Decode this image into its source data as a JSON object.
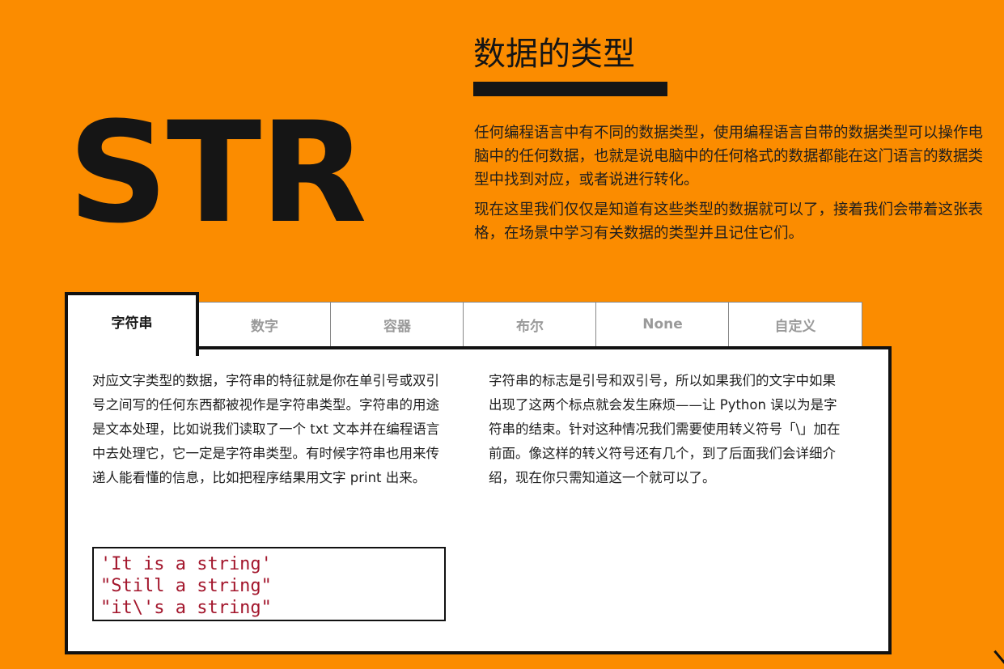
{
  "hero": {
    "text": "STR"
  },
  "section": {
    "title": "数据的类型"
  },
  "intro": {
    "paragraphs": [
      "任何编程语言中有不同的数据类型，使用编程语言自带的数据类型可以操作电脑中的任何数据，也就是说电脑中的任何格式的数据都能在这门语言的数据类型中找到对应，或者说进行转化。",
      "现在这里我们仅仅是知道有这些类型的数据就可以了，接着我们会带着这张表格，在场景中学习有关数据的类型并且记住它们。"
    ]
  },
  "tabs": [
    {
      "label": "字符串",
      "active": true
    },
    {
      "label": "数字",
      "active": false
    },
    {
      "label": "容器",
      "active": false
    },
    {
      "label": "布尔",
      "active": false
    },
    {
      "label": "None",
      "active": false
    },
    {
      "label": "自定义",
      "active": false
    }
  ],
  "panel": {
    "left_text": "对应文字类型的数据，字符串的特征就是你在单引号或双引号之间写的任何东西都被视作是字符串类型。字符串的用途是文本处理，比如说我们读取了一个 txt 文本并在编程语言中去处理它，它一定是字符串类型。有时候字符串也用来传递人能看懂的信息，比如把程序结果用文字 print 出来。",
    "right_text": "字符串的标志是引号和双引号，所以如果我们的文字中如果出现了这两个标点就会发生麻烦——让 Python 误以为是字符串的结束。针对这种情况我们需要使用转义符号「\\」加在前面。像这样的转义符号还有几个，到了后面我们会详细介绍，现在你只需知道这一个就可以了。",
    "code_lines": [
      "'It is a string'",
      "\"Still a string\"",
      "\"it\\'s a string\""
    ]
  },
  "colors": {
    "background": "#fb8c00",
    "text_dark": "#151515",
    "code": "#a3162c",
    "tab_inactive_text": "#9a9a9a"
  }
}
